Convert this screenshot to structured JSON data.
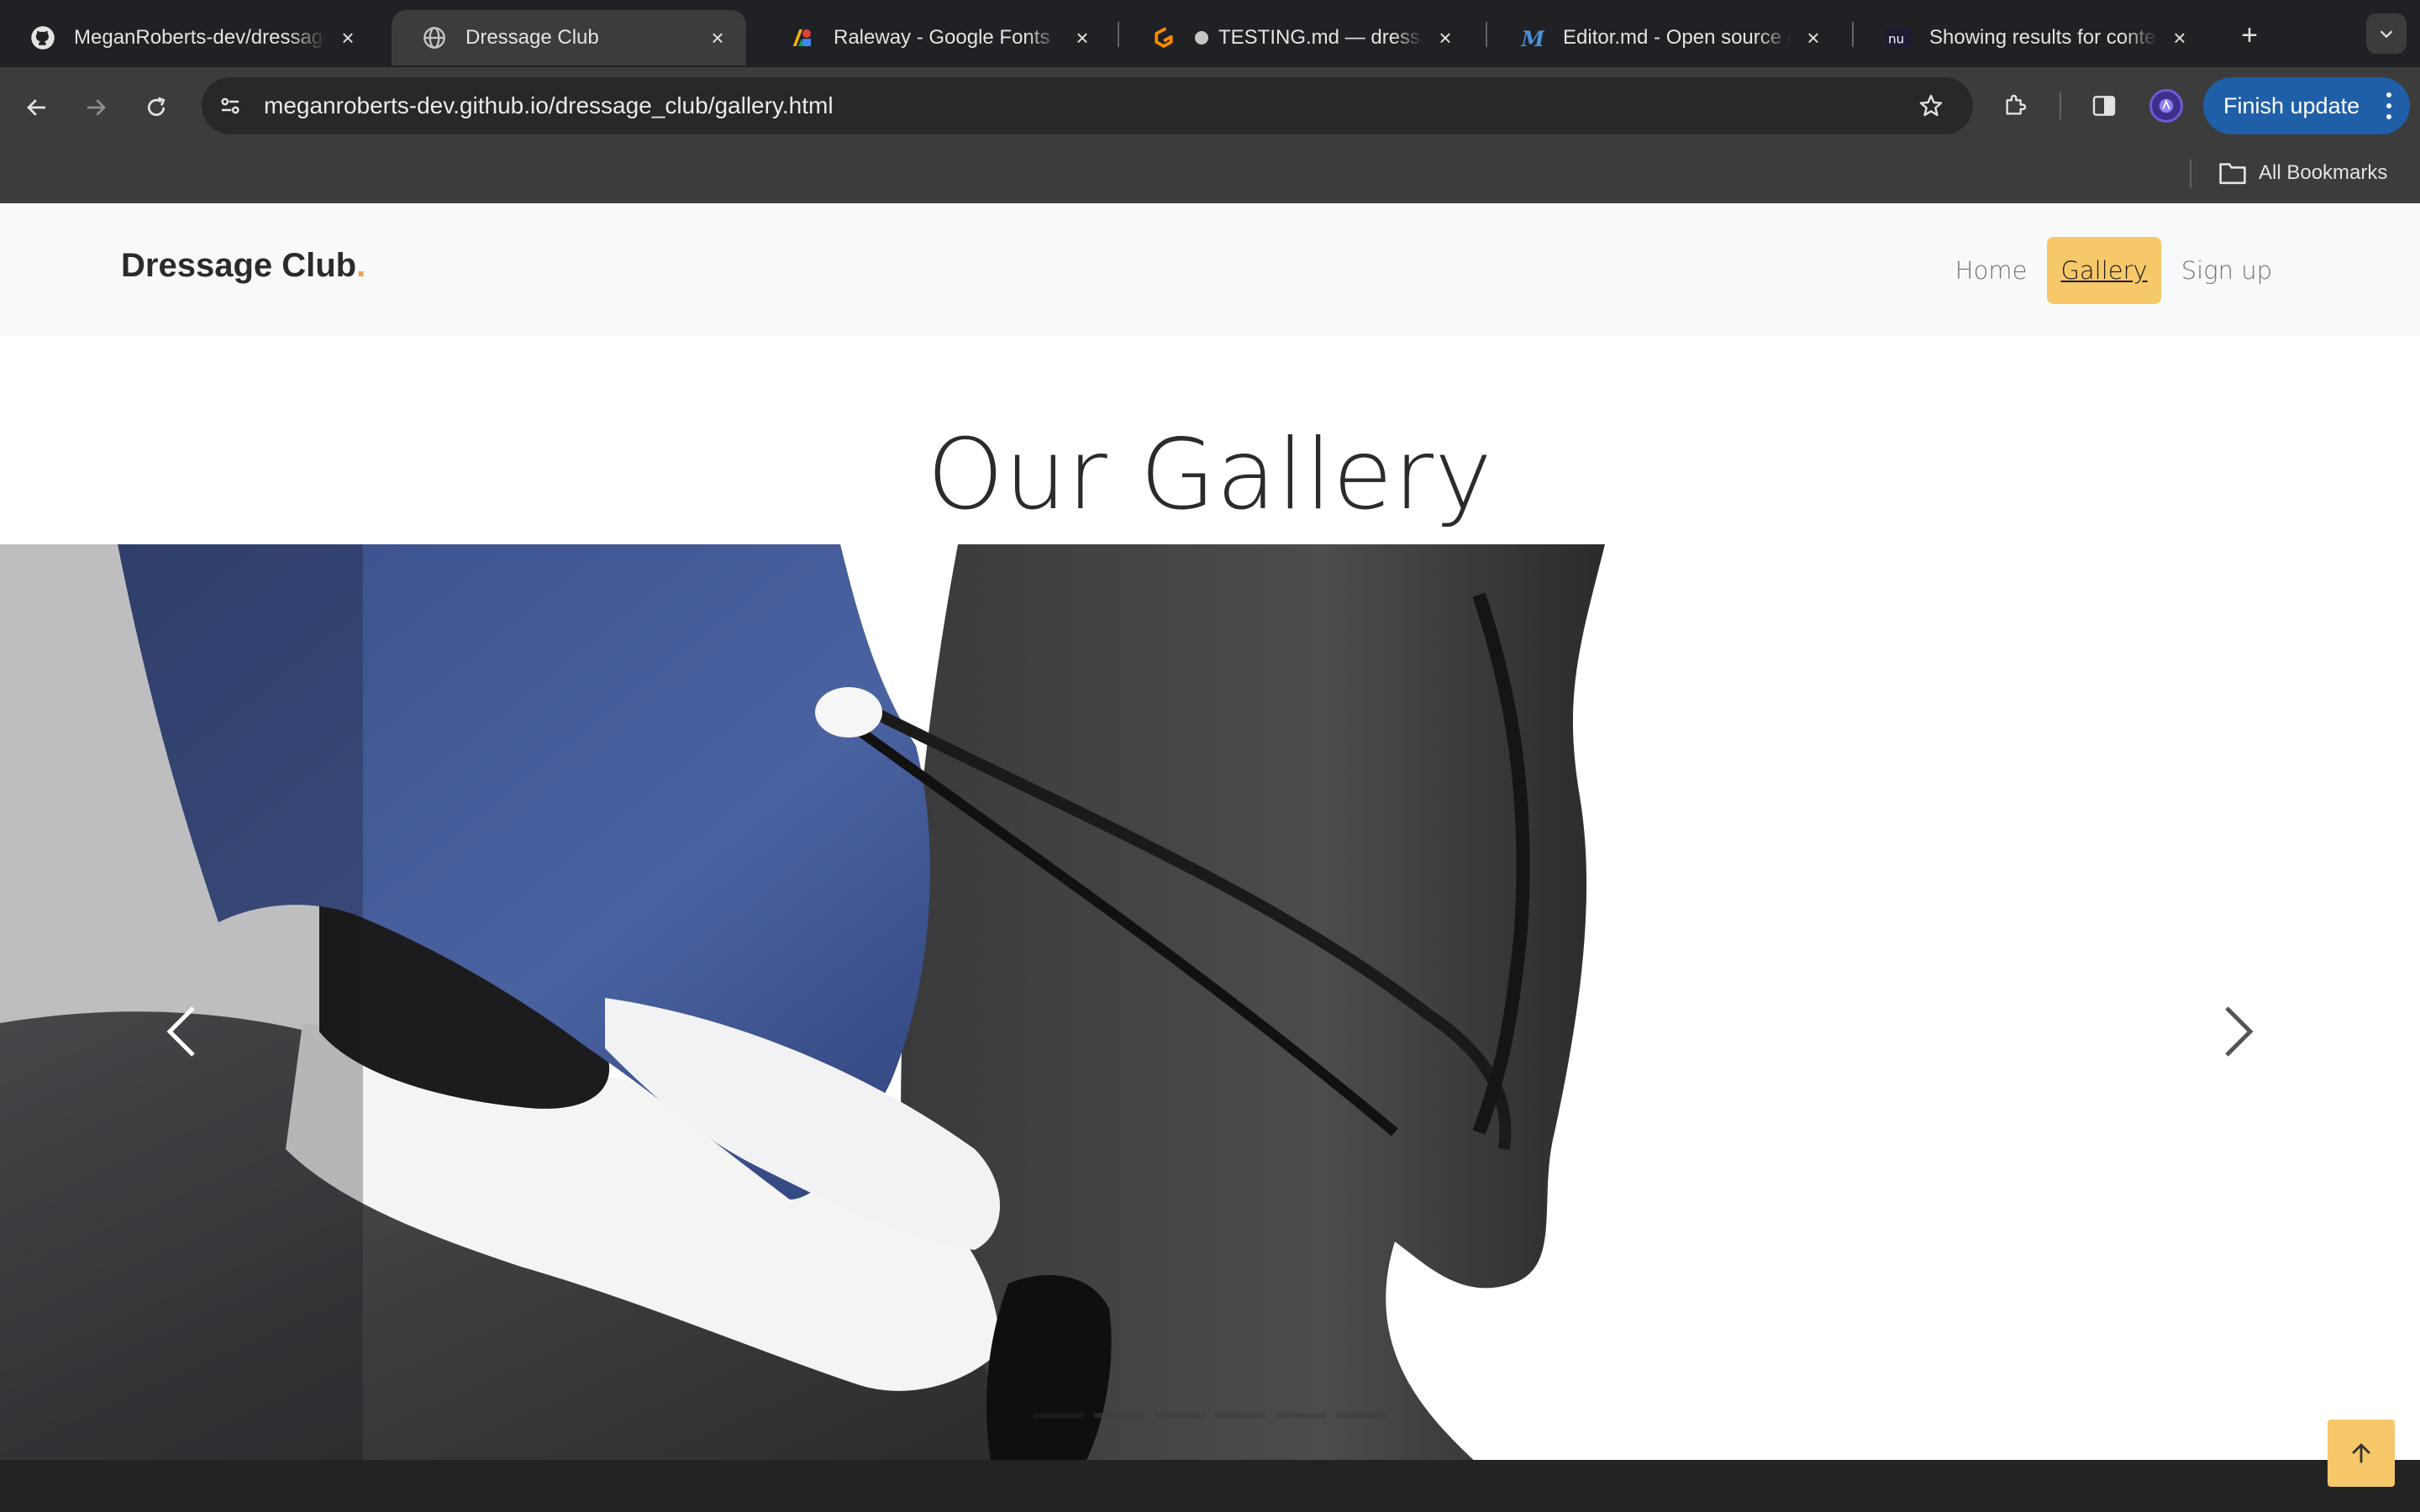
{
  "browser": {
    "tabs": [
      {
        "title": "MeganRoberts-dev/dressage_club",
        "icon": "github-icon"
      },
      {
        "title": "Dressage Club",
        "icon": "globe-icon",
        "active": true
      },
      {
        "title": "Raleway - Google Fonts",
        "icon": "google-fonts-icon"
      },
      {
        "title": "TESTING.md — dressage_club",
        "icon": "gitpod-icon"
      },
      {
        "title": "Editor.md - Open source online",
        "icon": "editor-md-icon"
      },
      {
        "title": "Showing results for contents",
        "icon": "nu-icon"
      }
    ],
    "url": "meganroberts-dev.github.io/dressage_club/gallery.html",
    "finish_update_label": "Finish update",
    "all_bookmarks_label": "All Bookmarks"
  },
  "site": {
    "brand": "Dressage Club",
    "brand_dot": ".",
    "nav": [
      {
        "label": "Home"
      },
      {
        "label": "Gallery",
        "active": true
      },
      {
        "label": "Sign up"
      }
    ],
    "gallery_title": "Our Gallery",
    "carousel": {
      "slide_count": 6,
      "active_index": 0,
      "image_description": "dressage rider in navy tailcoat on dark horse"
    },
    "colors": {
      "accent": "#f7c86a",
      "brand_dot": "#f0a44b",
      "header_bg": "#f8f9fa"
    }
  }
}
